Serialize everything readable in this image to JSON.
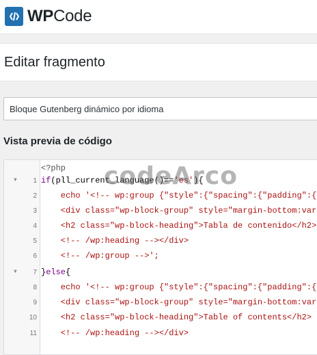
{
  "brand": {
    "name_bold": "WP",
    "name_rest": "Code"
  },
  "page": {
    "title": "Editar fragmento"
  },
  "snippet": {
    "title_value": "Bloque Gutenberg dinámico por idioma"
  },
  "preview": {
    "label": "Vista previa de código"
  },
  "watermark": "codeArco",
  "editor": {
    "open_tag": "<?php",
    "lines": [
      {
        "n": "1",
        "text": "if(pll_current_language()=='es'){"
      },
      {
        "n": "2",
        "text": "    echo '<!-- wp:group {\"style\":{\"spacing\":{\"padding\":{\"t"
      },
      {
        "n": "3",
        "text": "    <div class=\"wp-block-group\" style=\"margin-bottom:var(-"
      },
      {
        "n": "4",
        "text": "    <h2 class=\"wp-block-heading\">Tabla de contenido</h2>"
      },
      {
        "n": "5",
        "text": "    <!-- /wp:heading --></div>"
      },
      {
        "n": "6",
        "text": "    <!-- /wp:group -->';"
      },
      {
        "n": "7",
        "text": "}else{"
      },
      {
        "n": "8",
        "text": "    echo '<!-- wp:group {\"style\":{\"spacing\":{\"padding\":{\"t"
      },
      {
        "n": "9",
        "text": "    <div class=\"wp-block-group\" style=\"margin-bottom:var(-"
      },
      {
        "n": "10",
        "text": "    <h2 class=\"wp-block-heading\">Table of contents</h2>"
      },
      {
        "n": "11",
        "text": "    <!-- /wp:heading --></div>"
      }
    ]
  },
  "colors": {
    "accent": "#2271b1",
    "string": "#aa1111",
    "keyword": "#770088"
  }
}
